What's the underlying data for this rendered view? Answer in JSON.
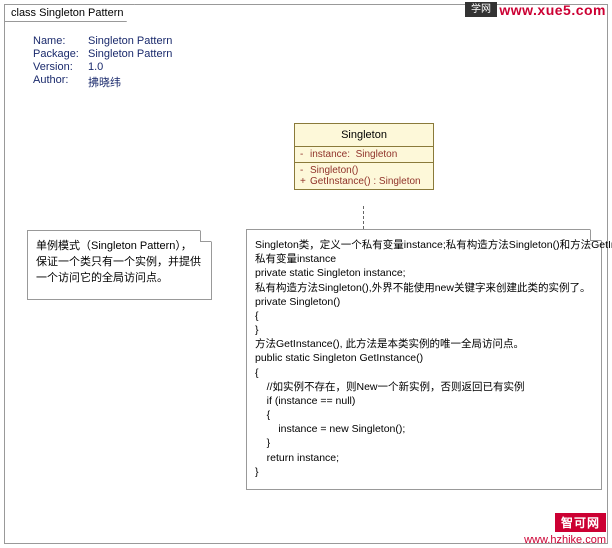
{
  "frame_title": "class Singleton Pattern",
  "badges": {
    "xue": "学网",
    "top": "www.xue5.com",
    "bottom_label": "智可网",
    "bottom_link": "www.hzhike.com"
  },
  "meta": [
    {
      "key": "Name:",
      "val": "Singleton Pattern"
    },
    {
      "key": "Package:",
      "val": "Singleton Pattern"
    },
    {
      "key": "Version:",
      "val": "1.0"
    },
    {
      "key": "Author:",
      "val": "拂晓纬"
    }
  ],
  "uml": {
    "name": "Singleton",
    "attrs": [
      {
        "vis": "-",
        "sig": "instance:",
        "type": "Singleton"
      }
    ],
    "ops": [
      {
        "vis": "-",
        "sig": "Singleton()",
        "type": ""
      },
      {
        "vis": "+",
        "sig": "GetInstance() :",
        "type": "Singleton"
      }
    ]
  },
  "note_left": "单例模式（Singleton Pattern），保证一个类只有一个实例，并提供一个访问它的全局访问点。",
  "note_right": "Singleton类，定义一个私有变量instance;私有构造方法Singleton()和方法GetInstance();\n私有变量instance\nprivate static Singleton instance;\n私有构造方法Singleton(),外界不能使用new关键字来创建此类的实例了。\nprivate Singleton()\n{\n}\n方法GetInstance(), 此方法是本类实例的唯一全局访问点。\npublic static Singleton GetInstance()\n{\n    //如实例不存在，则New一个新实例，否则返回已有实例\n    if (instance == null)\n    {\n        instance = new Singleton();\n    }\n    return instance;\n}"
}
